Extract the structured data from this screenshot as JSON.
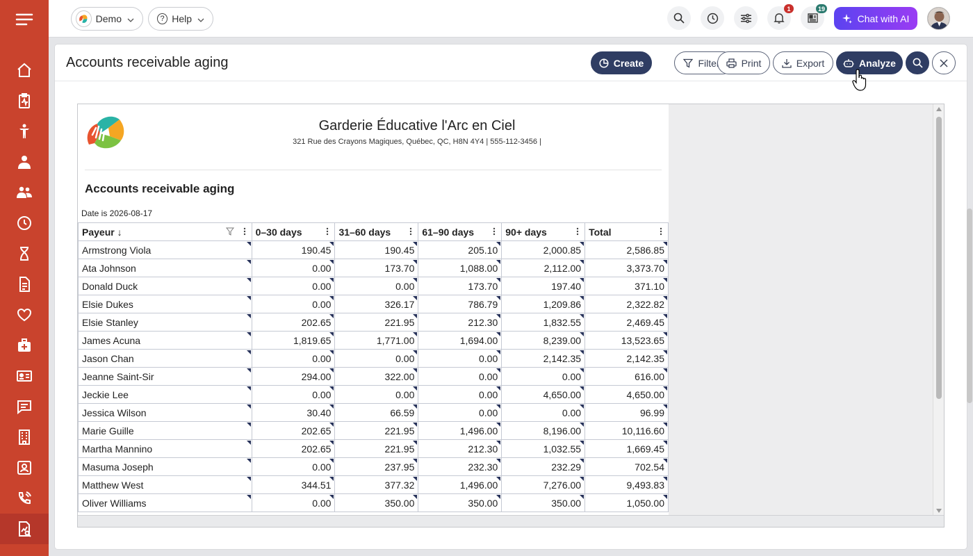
{
  "topbar": {
    "org_pill": "Demo",
    "help_pill": "Help",
    "notifications_badge": "1",
    "news_badge": "19",
    "chat_ai_label": "Chat with AI",
    "accent_chat": "#7a3ff2"
  },
  "panel": {
    "title": "Accounts receivable aging",
    "buttons": {
      "create": "Create",
      "filters": "Filters",
      "print": "Print",
      "export": "Export",
      "analyze": "Analyze"
    }
  },
  "report": {
    "org_name": "Garderie Éducative l'Arc en Ciel",
    "org_address": "321 Rue des Crayons Magiques, Québec, QC, H8N 4Y4 | 555-112-3456 |",
    "title": "Accounts receivable aging",
    "date_filter": "Date is 2026-08-17",
    "columns": [
      "Payeur ↓",
      "0–30 days",
      "31–60 days",
      "61–90 days",
      "90+ days",
      "Total"
    ],
    "rows": [
      [
        "Armstrong Viola",
        "190.45",
        "190.45",
        "205.10",
        "2,000.85",
        "2,586.85"
      ],
      [
        "Ata Johnson",
        "0.00",
        "173.70",
        "1,088.00",
        "2,112.00",
        "3,373.70"
      ],
      [
        "Donald Duck",
        "0.00",
        "0.00",
        "173.70",
        "197.40",
        "371.10"
      ],
      [
        "Elsie Dukes",
        "0.00",
        "326.17",
        "786.79",
        "1,209.86",
        "2,322.82"
      ],
      [
        "Elsie Stanley",
        "202.65",
        "221.95",
        "212.30",
        "1,832.55",
        "2,469.45"
      ],
      [
        "James Acuna",
        "1,819.65",
        "1,771.00",
        "1,694.00",
        "8,239.00",
        "13,523.65"
      ],
      [
        "Jason Chan",
        "0.00",
        "0.00",
        "0.00",
        "2,142.35",
        "2,142.35"
      ],
      [
        "Jeanne Saint-Sir",
        "294.00",
        "322.00",
        "0.00",
        "0.00",
        "616.00"
      ],
      [
        "Jeckie Lee",
        "0.00",
        "0.00",
        "0.00",
        "4,650.00",
        "4,650.00"
      ],
      [
        "Jessica Wilson",
        "30.40",
        "66.59",
        "0.00",
        "0.00",
        "96.99"
      ],
      [
        "Marie Guille",
        "202.65",
        "221.95",
        "1,496.00",
        "8,196.00",
        "10,116.60"
      ],
      [
        "Martha Mannino",
        "202.65",
        "221.95",
        "212.30",
        "1,032.55",
        "1,669.45"
      ],
      [
        "Masuma Joseph",
        "0.00",
        "237.95",
        "232.30",
        "232.29",
        "702.54"
      ],
      [
        "Matthew West",
        "344.51",
        "377.32",
        "1,496.00",
        "7,276.00",
        "9,493.83"
      ],
      [
        "Oliver Williams",
        "0.00",
        "350.00",
        "350.00",
        "350.00",
        "1,050.00"
      ]
    ]
  },
  "sidebar_icons": [
    "menu-icon",
    "home-icon",
    "clipboard-icon",
    "child-icon",
    "staff-icon",
    "family-icon",
    "clock-icon",
    "hourglass-icon",
    "document-icon",
    "heart-icon",
    "medical-kit-icon",
    "id-card-icon",
    "chat-icon",
    "building-icon",
    "contact-icon",
    "phone-icon",
    "reports-icon"
  ],
  "colors": {
    "sidebar": "#c9432d",
    "primary_button": "#2f3d63"
  }
}
